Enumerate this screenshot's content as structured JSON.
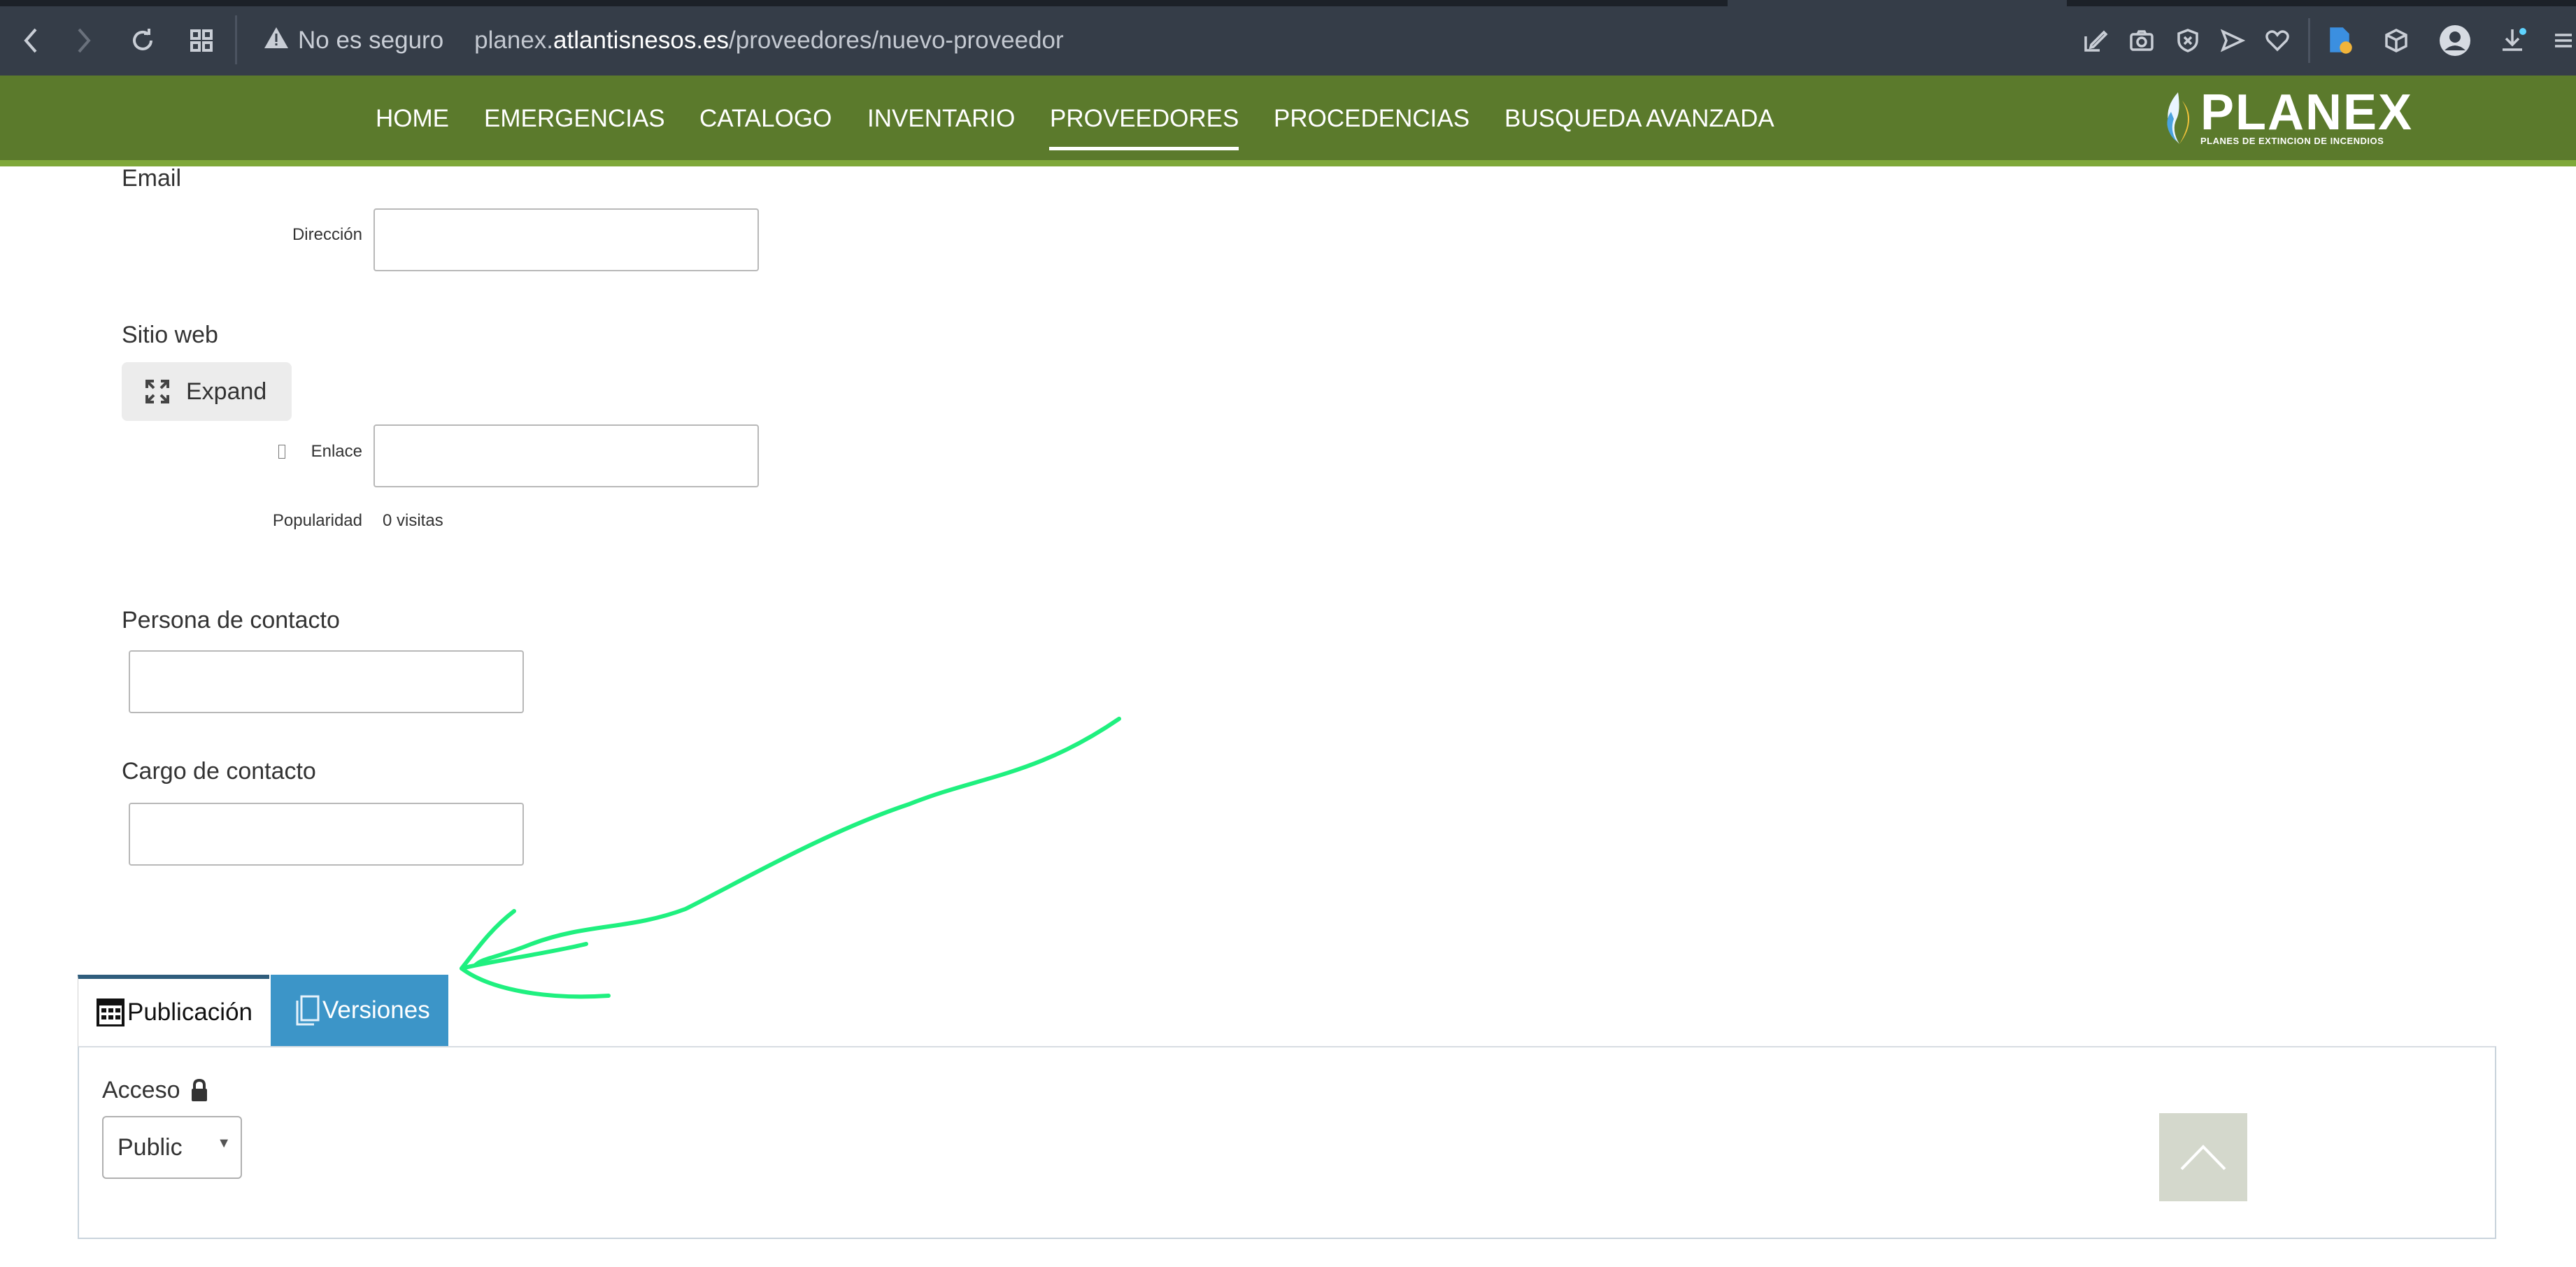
{
  "browser": {
    "security_warning": "No es seguro",
    "url_prefix": "planex.",
    "url_host": "atlantisnesos.es",
    "url_path": "/proveedores/nuevo-proveedor"
  },
  "nav": {
    "items": [
      "HOME",
      "EMERGENCIAS",
      "CATALOGO",
      "INVENTARIO",
      "PROVEEDORES",
      "PROCEDENCIAS",
      "BUSQUEDA AVANZADA"
    ],
    "active": "PROVEEDORES"
  },
  "logo": {
    "title": "PLANEX",
    "subtitle": "PLANES DE EXTINCION DE INCENDIOS"
  },
  "form": {
    "email": {
      "section": "Email",
      "direccion_label": "Dirección",
      "direccion_value": ""
    },
    "sitio_web": {
      "section": "Sitio web",
      "expand_label": "Expand",
      "enlace_label": "Enlace",
      "enlace_value": "",
      "popularidad_label": "Popularidad",
      "popularidad_value": "0 visitas"
    },
    "persona_contacto": {
      "label": "Persona de contacto",
      "value": ""
    },
    "cargo_contacto": {
      "label": "Cargo de contacto",
      "value": ""
    }
  },
  "tabs": {
    "publicacion": "Publicación",
    "versiones": "Versiones"
  },
  "publicacion": {
    "acceso_label": "Acceso",
    "acceso_value": "Public"
  },
  "colors": {
    "nav_bg": "#5b7a2c",
    "tab_active_border": "#2f5d7c",
    "tab_versiones_bg": "#3c95c8",
    "annotation_arrow": "#1ff07f"
  },
  "icons": {
    "expand": "expand-arrows-icon",
    "publicacion": "calendar-grid-icon",
    "versiones": "copy-pages-icon",
    "acceso": "lock-icon",
    "back_to_top": "chevron-up-icon"
  }
}
